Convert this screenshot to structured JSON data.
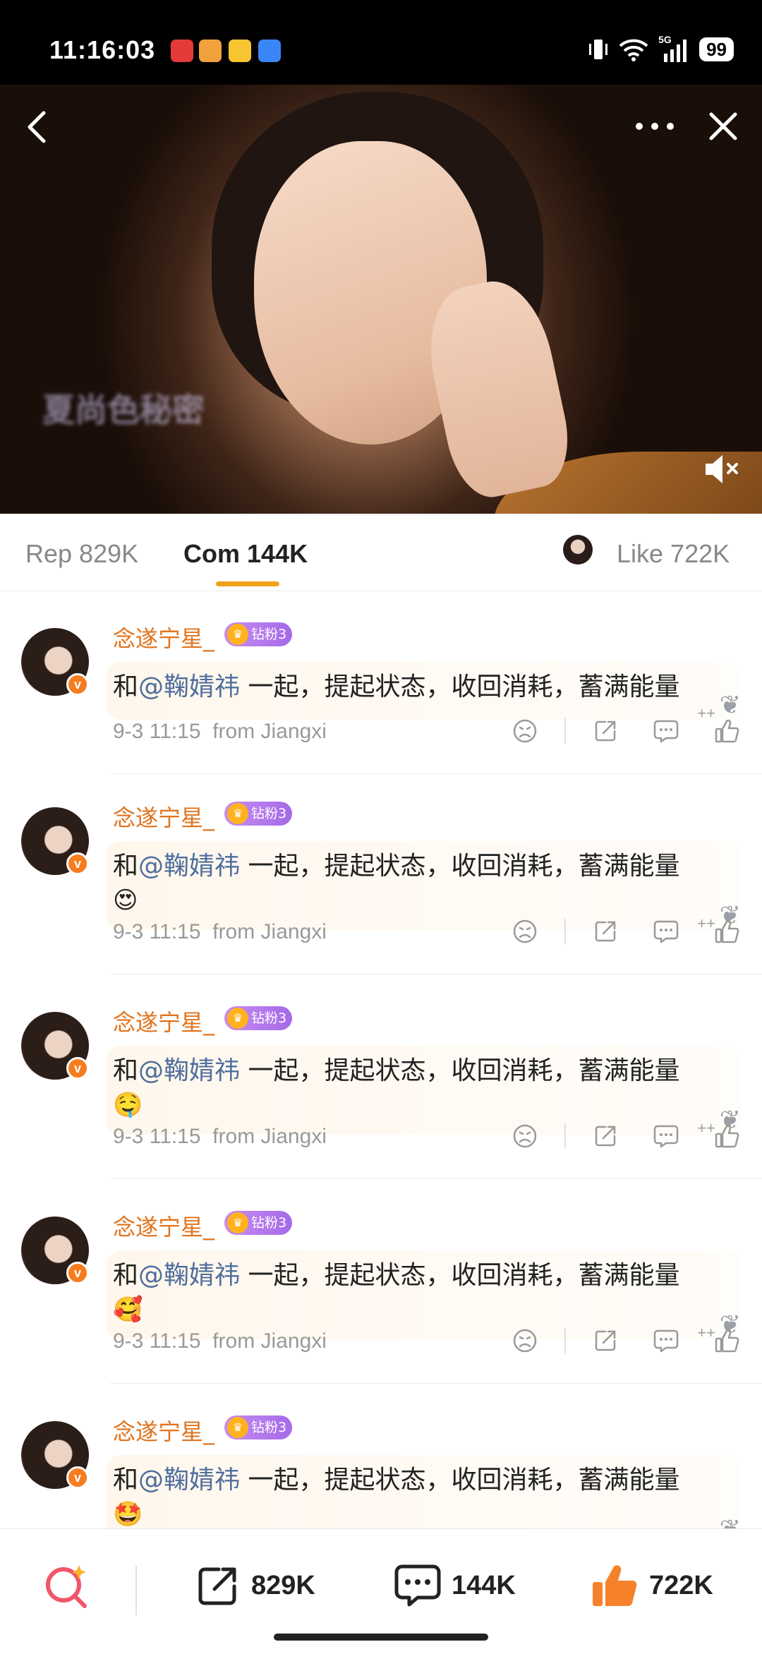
{
  "status_bar": {
    "time": "11:16:03",
    "network": "5G",
    "battery": "99",
    "notification_icons": [
      "app-icon-red",
      "app-icon-video",
      "weibo-icon",
      "app-icon-blue"
    ]
  },
  "video": {
    "overlay_text": "夏尚色秘密"
  },
  "tabs": {
    "repost": "Rep 829K",
    "comment": "Com 144K",
    "like": "Like 722K",
    "active": "comment"
  },
  "comments": [
    {
      "username": "念遂宁星_",
      "badge": "钻粉3",
      "prefix": "和",
      "mention": "@鞠婧祎",
      "body": " 一起，提起状态，收回消耗，蓄满能量",
      "emoji": "",
      "date": "9-3 11:15",
      "location": "from Jiangxi"
    },
    {
      "username": "念遂宁星_",
      "badge": "钻粉3",
      "prefix": "和",
      "mention": "@鞠婧祎",
      "body": " 一起，提起状态，收回消耗，蓄满能量",
      "emoji": "😍",
      "date": "9-3 11:15",
      "location": "from Jiangxi"
    },
    {
      "username": "念遂宁星_",
      "badge": "钻粉3",
      "prefix": "和",
      "mention": "@鞠婧祎",
      "body": " 一起，提起状态，收回消耗，蓄满能量",
      "emoji": "🤤",
      "date": "9-3 11:15",
      "location": "from Jiangxi"
    },
    {
      "username": "念遂宁星_",
      "badge": "钻粉3",
      "prefix": "和",
      "mention": "@鞠婧祎",
      "body": " 一起，提起状态，收回消耗，蓄满能量",
      "emoji": "🥰",
      "date": "9-3 11:15",
      "location": "from Jiangxi"
    },
    {
      "username": "念遂宁星_",
      "badge": "钻粉3",
      "prefix": "和",
      "mention": "@鞠婧祎",
      "body": " 一起，提起状态，收回消耗，蓄满能量",
      "emoji": "🤩",
      "date": "",
      "location": ""
    }
  ],
  "bottom_bar": {
    "repost_count": "829K",
    "comment_count": "144K",
    "like_count": "722K"
  },
  "colors": {
    "username": "#e1731c",
    "mention": "#4f6e9e",
    "tab_underline": "#f0a21a",
    "like_orange": "#f5822a",
    "search_red": "#f0566a"
  }
}
